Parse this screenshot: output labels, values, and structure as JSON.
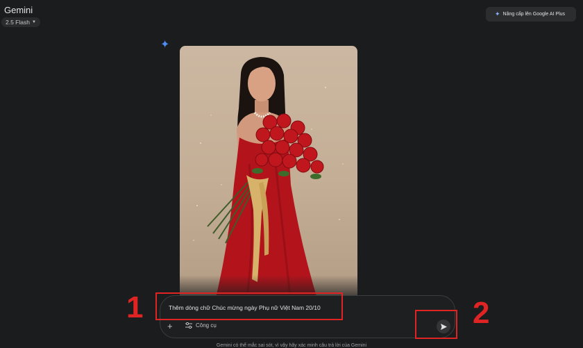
{
  "header": {
    "app_title": "Gemini",
    "model_label": "2.5 Flash",
    "upgrade_label": "Nâng cấp lên Google AI Plus"
  },
  "composer": {
    "prompt_text": "Thêm dòng chữ Chúc mừng ngày Phụ nữ Việt Nam 20/10",
    "tools_label": "Công cụ"
  },
  "annotations": {
    "step1": "1",
    "step2": "2"
  },
  "footer": {
    "disclaimer": "Gemini có thể mắc sai sót, vì vậy hãy xác minh câu trả lời của Gemini"
  },
  "colors": {
    "background": "#1b1c1d",
    "highlight_red": "#e02424",
    "accent_blue": "#4c8df6"
  }
}
